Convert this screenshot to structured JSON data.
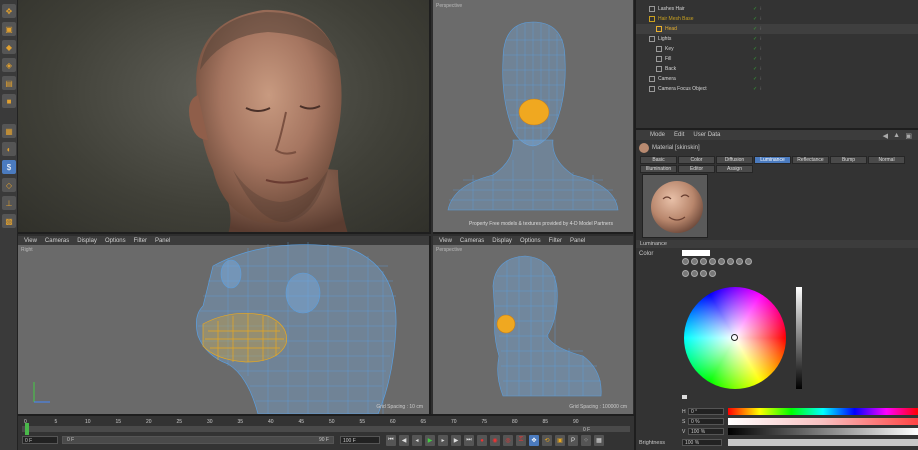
{
  "viewports": {
    "top_right": {
      "label": "Perspective",
      "credit": "Property Free models & textures provided by 4-D Model Partners"
    },
    "right_view": {
      "menu": [
        "View",
        "Cameras",
        "Display",
        "Options",
        "Filter",
        "Panel"
      ],
      "label": "Right",
      "grid_spacing": "Grid Spacing : 10 cm"
    },
    "bottom_persp": {
      "menu": [
        "View",
        "Cameras",
        "Display",
        "Options",
        "Filter",
        "Panel"
      ],
      "label": "Perspective",
      "grid_spacing": "Grid Spacing : 100000 cm"
    }
  },
  "object_manager": {
    "rows": [
      {
        "name": "Lashes Hair",
        "indent": 1,
        "selected": false
      },
      {
        "name": "Hair Mesh Base",
        "indent": 1,
        "selected": false,
        "color": "#c8a020"
      },
      {
        "name": "Head",
        "indent": 2,
        "selected": true,
        "color": "#e8b030"
      },
      {
        "name": "Lights",
        "indent": 1,
        "selected": false
      },
      {
        "name": "Key",
        "indent": 2,
        "selected": false
      },
      {
        "name": "Fill",
        "indent": 2,
        "selected": false
      },
      {
        "name": "Back",
        "indent": 2,
        "selected": false
      },
      {
        "name": "Camera",
        "indent": 1,
        "selected": false
      },
      {
        "name": "Camera Focus Object",
        "indent": 1,
        "selected": false
      }
    ]
  },
  "attribute_manager": {
    "menu": [
      "Mode",
      "Edit",
      "User Data"
    ],
    "material_title": "Material [skinskin]",
    "tabs_row1": [
      "Basic",
      "Color",
      "Diffusion",
      "Luminance",
      "Reflectance",
      "Bump",
      "Normal"
    ],
    "tabs_row2": [
      "Illumination",
      "Editor",
      "Assign"
    ],
    "active_tab": "Luminance",
    "section_title": "Luminance",
    "color_label": "Color",
    "h_label": "H",
    "h_value": "0 °",
    "s_label": "S",
    "s_value": "0 %",
    "v_label": "V",
    "v_value": "100 %",
    "brightness_label": "Brightness",
    "brightness_value": "100 %"
  },
  "timeline": {
    "frame_numbers": [
      "0",
      "5",
      "10",
      "15",
      "20",
      "25",
      "30",
      "35",
      "40",
      "45",
      "50",
      "55",
      "60",
      "65",
      "70",
      "75",
      "80",
      "85",
      "90"
    ],
    "current_frame": "0 F",
    "start_field": "0 F",
    "end_field": "90 F",
    "range_end": "100 F",
    "end_label": "0 F"
  },
  "colors": {
    "accent_blue": "#4b7bbf",
    "highlight_orange": "#e8a820",
    "wireframe_blue": "#5a9fe0"
  }
}
